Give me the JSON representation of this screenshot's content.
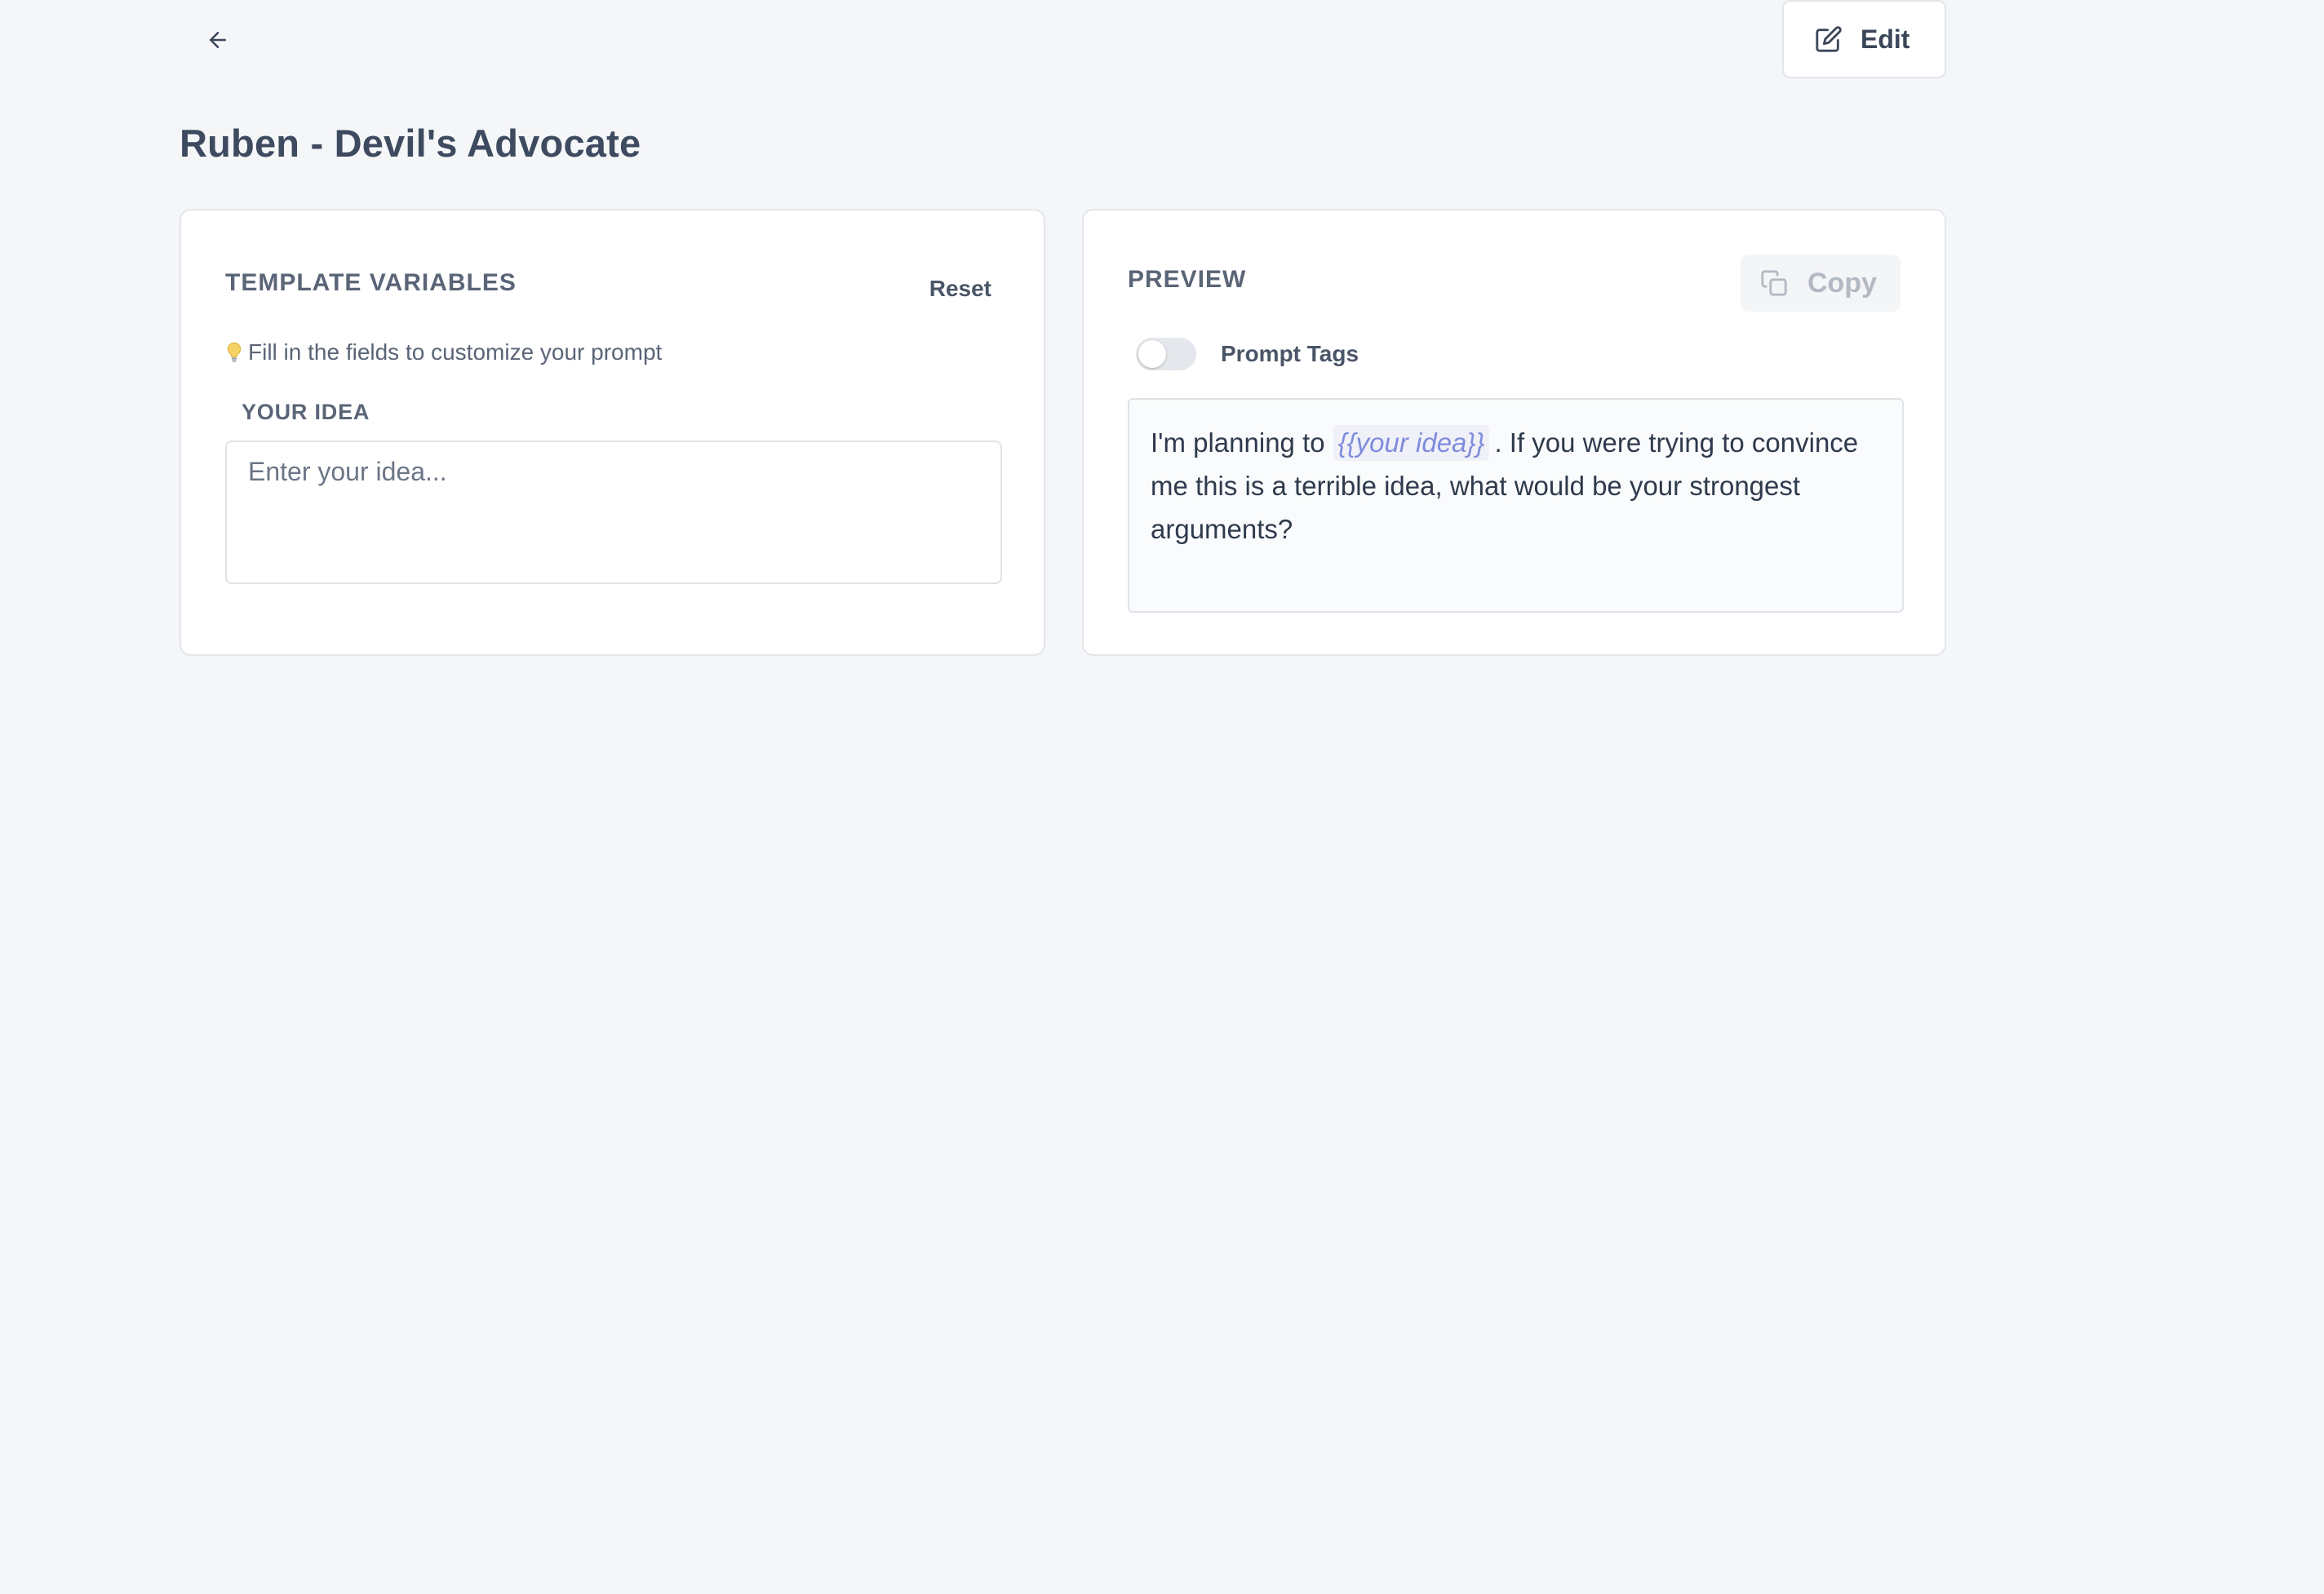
{
  "header": {
    "title": "Ruben - Devil's Advocate",
    "edit_label": "Edit"
  },
  "variables_panel": {
    "title": "TEMPLATE VARIABLES",
    "reset_label": "Reset",
    "hint": "Fill in the fields to customize your prompt",
    "fields": [
      {
        "label": "YOUR IDEA",
        "placeholder": "Enter your idea...",
        "value": ""
      }
    ]
  },
  "preview_panel": {
    "title": "PREVIEW",
    "copy_label": "Copy",
    "toggle_label": "Prompt Tags",
    "toggle_on": false,
    "text_before": "I'm planning to",
    "variable_tag": "{{your idea}}",
    "text_after": ". If you were trying to convince me this is a terrible idea, what would be your strongest arguments?"
  },
  "icons": {
    "back": "arrow-left-icon",
    "edit": "edit-pencil-icon",
    "copy": "copy-icon",
    "hint": "lightbulb-icon"
  },
  "colors": {
    "background": "#f5f6f8",
    "variable_tag_text": "#7f8cdc",
    "variable_tag_bg": "#f0f1f8",
    "title_text": "#3d4a5f"
  }
}
